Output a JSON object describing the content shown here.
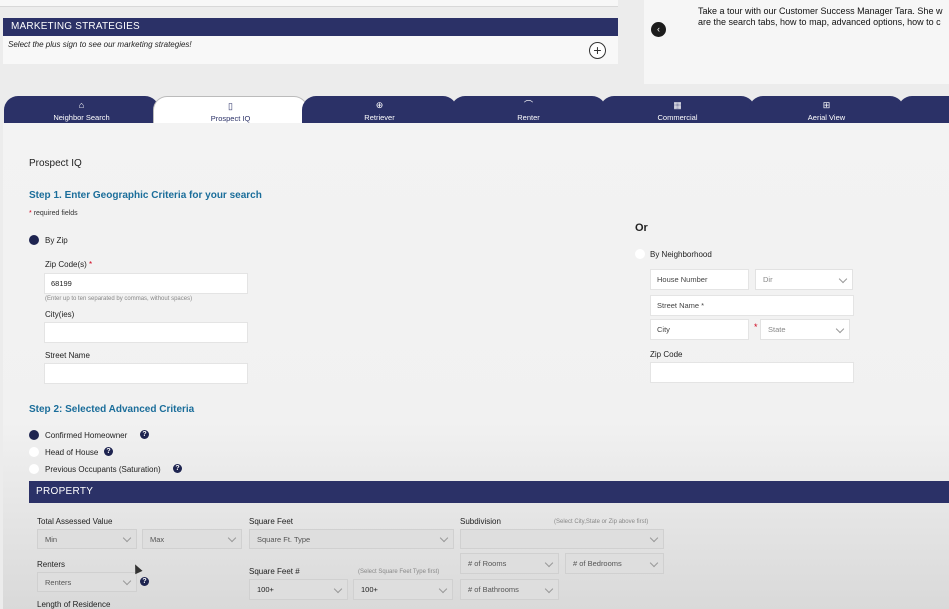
{
  "marketing": {
    "header": "MARKETING STRATEGIES",
    "note": "Select the plus sign to see our marketing strategies!",
    "plus_glyph": "+"
  },
  "tour": {
    "line1": "Take a tour with our Customer Success Manager Tara. She w",
    "line2": "are the search tabs, how to map, advanced options, how to c",
    "arrow_glyph": "‹"
  },
  "tabs": [
    {
      "label": "Neighbor Search",
      "icon": "home-icon",
      "glyph": "⌂"
    },
    {
      "label": "Prospect IQ",
      "icon": "phone-icon",
      "glyph": "▯"
    },
    {
      "label": "Retriever",
      "icon": "download-icon",
      "glyph": "⊕"
    },
    {
      "label": "Renter",
      "icon": "shoe-icon",
      "glyph": "⌒"
    },
    {
      "label": "Commercial",
      "icon": "building-icon",
      "glyph": "▦"
    },
    {
      "label": "Aerial View",
      "icon": "plane-icon",
      "glyph": "⊞"
    }
  ],
  "page_title": "Prospect IQ",
  "step1": {
    "title": "Step 1. Enter Geographic Criteria for your search",
    "required_mark": "*",
    "required_note": "required fields",
    "by_zip": "By Zip",
    "zip_label": "Zip Code(s)",
    "zip_value": "68199",
    "zip_help": "(Enter up to ten separated by commas, without spaces)",
    "city_label": "City(ies)",
    "street_label": "Street Name",
    "or": "Or",
    "by_neighborhood": "By Neighborhood",
    "house_number_ph": "House Number",
    "dir_ph": "Dir",
    "street_name_ph": "Street Name *",
    "city_ph": "City",
    "state_ph": "State",
    "zip_code_label": "Zip Code"
  },
  "step2": {
    "title": "Step 2: Selected Advanced Criteria",
    "options": [
      {
        "label": "Confirmed Homeowner",
        "selected": true
      },
      {
        "label": "Head of House",
        "selected": false
      },
      {
        "label": "Previous Occupants (Saturation)",
        "selected": false
      }
    ],
    "help_glyph": "?"
  },
  "property": {
    "header": "PROPERTY",
    "total_assessed_value": "Total Assessed Value",
    "min_ph": "Min",
    "max_ph": "Max",
    "square_feet": "Square Feet",
    "square_ft_type_ph": "Square Ft. Type",
    "subdivision": "Subdivision",
    "subdivision_help": "(Select City,State or Zip above first)",
    "renters": "Renters",
    "renters_ph": "Renters",
    "square_feet_num": "Square Feet #",
    "square_feet_num_help": "(Select Square Feet Type first)",
    "sqft_from": "100+",
    "sqft_to": "100+",
    "rooms_ph": "# of Rooms",
    "bedrooms_ph": "# of Bedrooms",
    "bathrooms_ph": "# of Bathrooms",
    "length_of_residence": "Length of Residence"
  },
  "colors": {
    "navy": "#2b3167",
    "step_blue": "#1a6d9a",
    "required_red": "#d0021b"
  }
}
